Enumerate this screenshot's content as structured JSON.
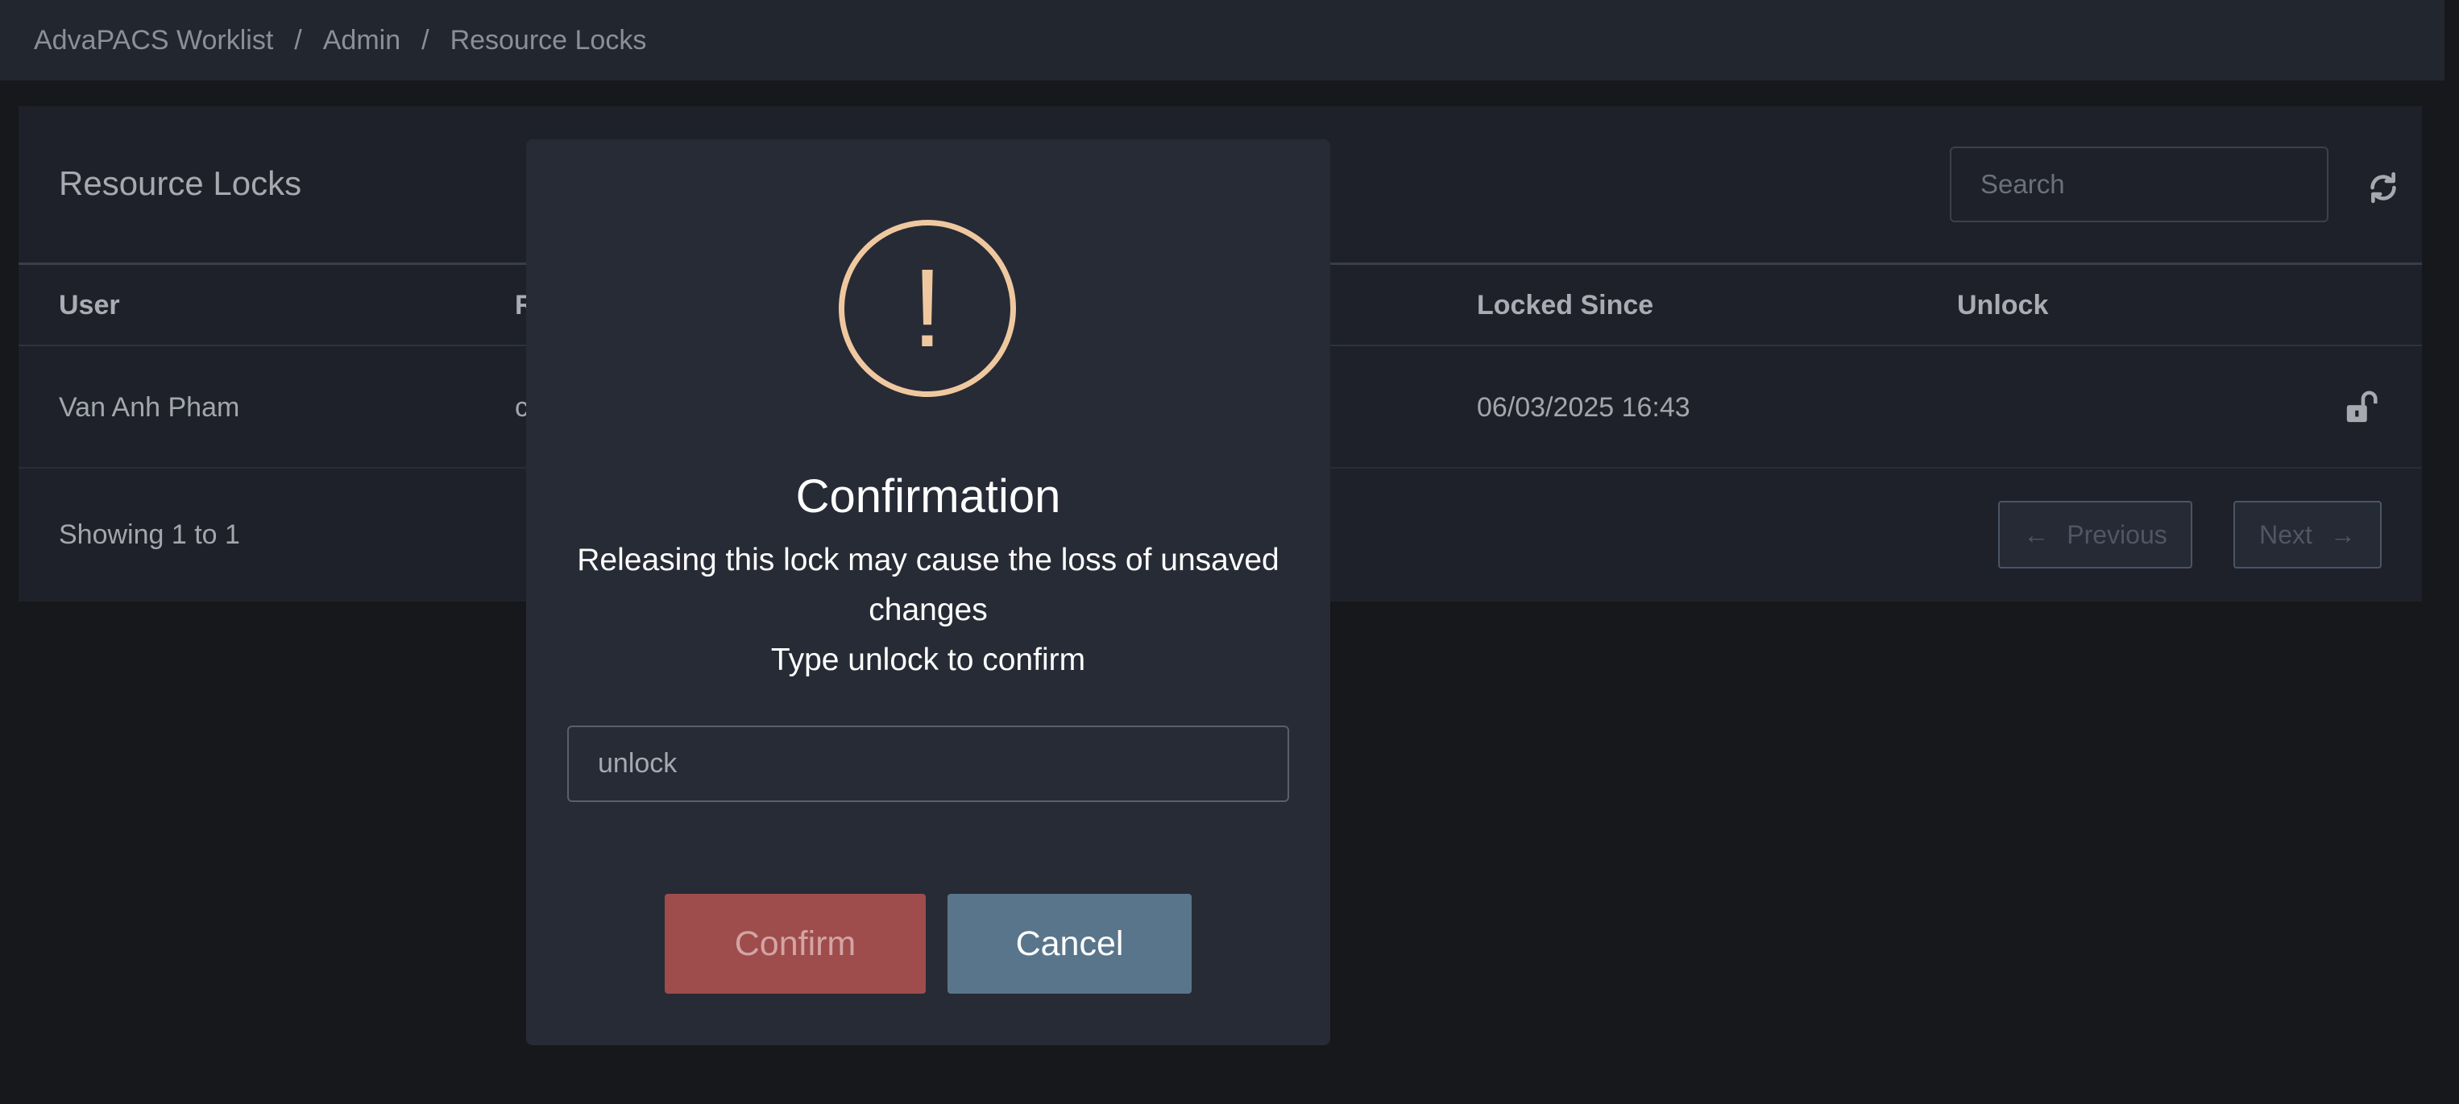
{
  "breadcrumb": {
    "items": [
      "AdvaPACS Worklist",
      "Admin",
      "Resource Locks"
    ],
    "separator": "/"
  },
  "panel": {
    "title": "Resource Locks",
    "search_placeholder": "Search",
    "columns": [
      "User",
      "R",
      "Locked Since",
      "Unlock"
    ],
    "rows": [
      {
        "user": "Van Anh Pham",
        "resource": "c",
        "locked_since": "06/03/2025 16:43"
      }
    ],
    "showing": "Showing 1 to 1",
    "previous_label": "Previous",
    "next_label": "Next",
    "prev_arrow": "←",
    "next_arrow": "→"
  },
  "modal": {
    "icon": "!",
    "title": "Confirmation",
    "message_line1": "Releasing this lock may cause the loss of unsaved changes",
    "message_line2": "Type unlock to confirm",
    "input_value": "unlock",
    "confirm_label": "Confirm",
    "cancel_label": "Cancel"
  },
  "colors": {
    "warning": "#f0c8a0",
    "confirm_bg": "#9e4d4c",
    "cancel_bg": "#59758b",
    "background": "#17181b"
  }
}
